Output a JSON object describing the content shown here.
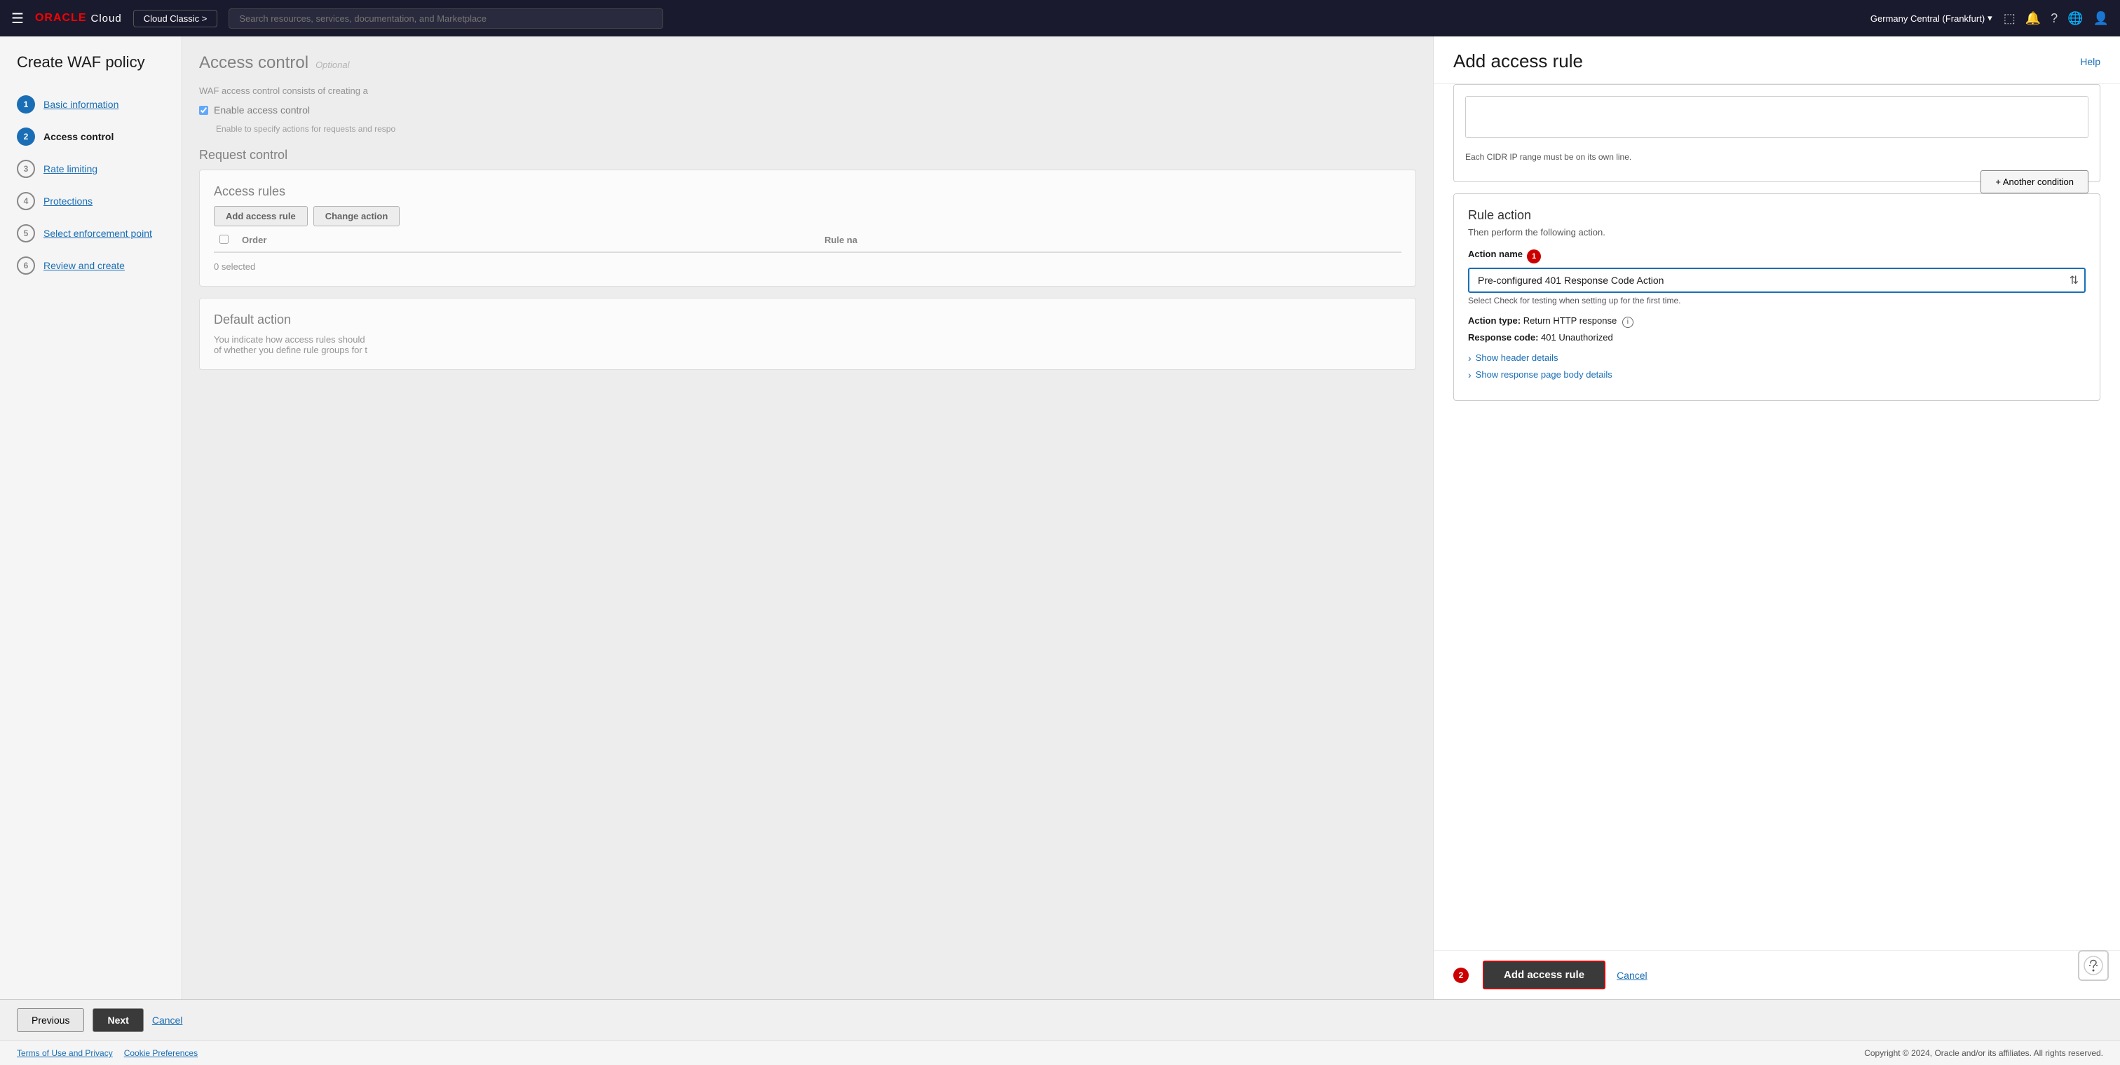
{
  "topnav": {
    "hamburger": "☰",
    "oracle_text": "ORACLE",
    "cloud_text": "Cloud",
    "cloud_classic_label": "Cloud Classic >",
    "search_placeholder": "Search resources, services, documentation, and Marketplace",
    "region": "Germany Central (Frankfurt)",
    "region_chevron": "▾",
    "nav_icon_monitor": "⬚",
    "nav_icon_bell": "🔔",
    "nav_icon_question": "?",
    "nav_icon_globe": "🌐",
    "nav_icon_user": "👤"
  },
  "sidebar": {
    "title": "Create WAF policy",
    "steps": [
      {
        "num": "1",
        "label": "Basic information",
        "state": "link"
      },
      {
        "num": "2",
        "label": "Access control",
        "state": "active"
      },
      {
        "num": "3",
        "label": "Rate limiting",
        "state": "link"
      },
      {
        "num": "4",
        "label": "Protections",
        "state": "link"
      },
      {
        "num": "5",
        "label": "Select enforcement point",
        "state": "link"
      },
      {
        "num": "6",
        "label": "Review and create",
        "state": "link"
      }
    ]
  },
  "center": {
    "access_control_title": "Access control",
    "access_control_optional": "Optional",
    "access_control_desc": "WAF access control consists of creating a",
    "enable_checkbox_label": "Enable access control",
    "enable_checkbox_hint": "Enable to specify actions for requests and respo",
    "request_control_title": "Request control",
    "access_rules_title": "Access rules",
    "add_rule_btn": "Add access rule",
    "change_action_btn": "Change action",
    "col_order": "Order",
    "col_rule_name": "Rule na",
    "selected_text": "0 selected",
    "default_action_title": "Default action",
    "default_action_desc": "You indicate how access rules should",
    "default_action_desc2": "of whether you define rule groups for t"
  },
  "right_panel": {
    "title": "Add access rule",
    "help_label": "Help",
    "cidr_note": "Each CIDR IP range must be on its own line.",
    "another_condition_btn": "+ Another condition",
    "rule_action_title": "Rule action",
    "rule_action_desc": "Then perform the following action.",
    "action_name_label": "Action name",
    "badge_1": "1",
    "action_select_value": "Pre-configured 401 Response Code Action",
    "action_select_hint": "Select Check for testing when setting up for the first time.",
    "action_type_label": "Action type:",
    "action_type_value": "Return HTTP response",
    "info_icon": "i",
    "response_code_label": "Response code:",
    "response_code_value": "401 Unauthorized",
    "show_header_details": "Show header details",
    "show_response_body": "Show response page body details",
    "badge_2": "2",
    "add_access_rule_btn": "Add access rule",
    "cancel_btn": "Cancel"
  },
  "bottom_bar": {
    "previous_btn": "Previous",
    "next_btn": "Next",
    "cancel_btn": "Cancel"
  },
  "footer": {
    "terms_link": "Terms of Use and Privacy",
    "cookie_link": "Cookie Preferences",
    "copyright": "Copyright © 2024, Oracle and/or its affiliates. All rights reserved."
  }
}
